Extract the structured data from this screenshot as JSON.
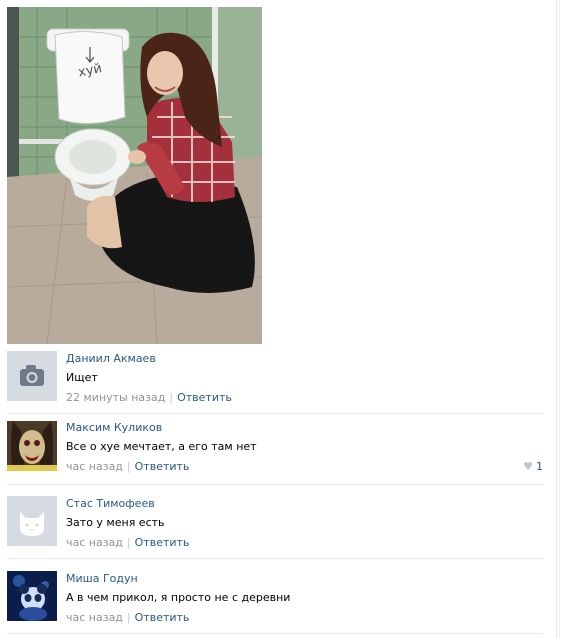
{
  "post": {
    "photo_caption_handwriting": "хуй"
  },
  "comments": [
    {
      "author": "Даниил Акмаев",
      "text": "Ищет",
      "time": "22 минуты назад",
      "separator": "|",
      "reply": "Ответить",
      "avatar": "camera-placeholder-icon",
      "likes": ""
    },
    {
      "author": "Максим Куликов",
      "text": "Все о хуе мечтает, а его там нет",
      "time": "час назад",
      "separator": "|",
      "reply": "Ответить",
      "avatar": "zombie-face-photo",
      "likes": "1"
    },
    {
      "author": "Стас Тимофеев",
      "text": "Зато у меня есть",
      "time": "час назад",
      "separator": "|",
      "reply": "Ответить",
      "avatar": "cat-placeholder-icon",
      "likes": ""
    },
    {
      "author": "Миша Годун",
      "text": "А в чем прикол, я просто не с деревни",
      "time": "час назад",
      "separator": "|",
      "reply": "Ответить",
      "avatar": "blue-panda-photo",
      "likes": ""
    }
  ],
  "colors": {
    "link": "#2a5885",
    "meta": "#939393",
    "divider": "#e7e8ec",
    "like_heart": "#bcc6d1"
  }
}
